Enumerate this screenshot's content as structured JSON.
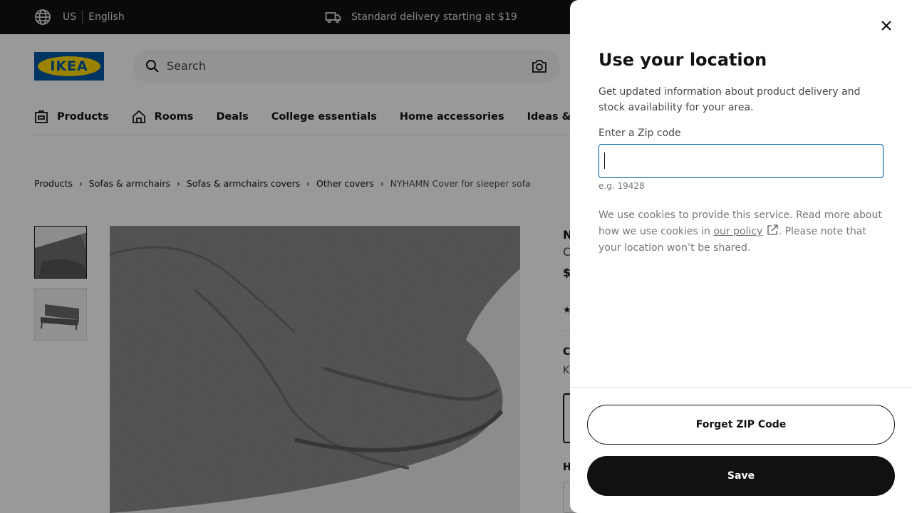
{
  "topbar": {
    "country": "US",
    "language": "English",
    "delivery_text": "Standard delivery starting at $19"
  },
  "header": {
    "logo_text": "IKEA",
    "search_placeholder": "Search"
  },
  "nav": {
    "items": [
      {
        "label": "Products"
      },
      {
        "label": "Rooms"
      },
      {
        "label": "Deals"
      },
      {
        "label": "College essentials"
      },
      {
        "label": "Home accessories"
      },
      {
        "label": "Ideas & inspira"
      }
    ]
  },
  "breadcrumb": {
    "items": [
      "Products",
      "Sofas & armchairs",
      "Sofas & armchairs covers",
      "Other covers"
    ],
    "current": "NYHAMN Cover for sleeper sofa"
  },
  "product_peek": {
    "letters": [
      "N",
      "C",
      "$",
      "C",
      "K",
      "H"
    ]
  },
  "modal": {
    "title": "Use your location",
    "description": "Get updated information about product delivery and stock availability for your area.",
    "zip_label": "Enter a Zip code",
    "zip_value": "",
    "zip_hint": "e.g. 19428",
    "cookie_text_before": "We use cookies to provide this service. Read more about how we use cookies in ",
    "cookie_link": "our policy",
    "cookie_text_after": ". Please note that your location won’t be shared.",
    "forget_button": "Forget ZIP Code",
    "save_button": "Save"
  },
  "colors": {
    "brand_blue": "#0058a3",
    "brand_yellow": "#ffdb00",
    "dark": "#111111"
  }
}
